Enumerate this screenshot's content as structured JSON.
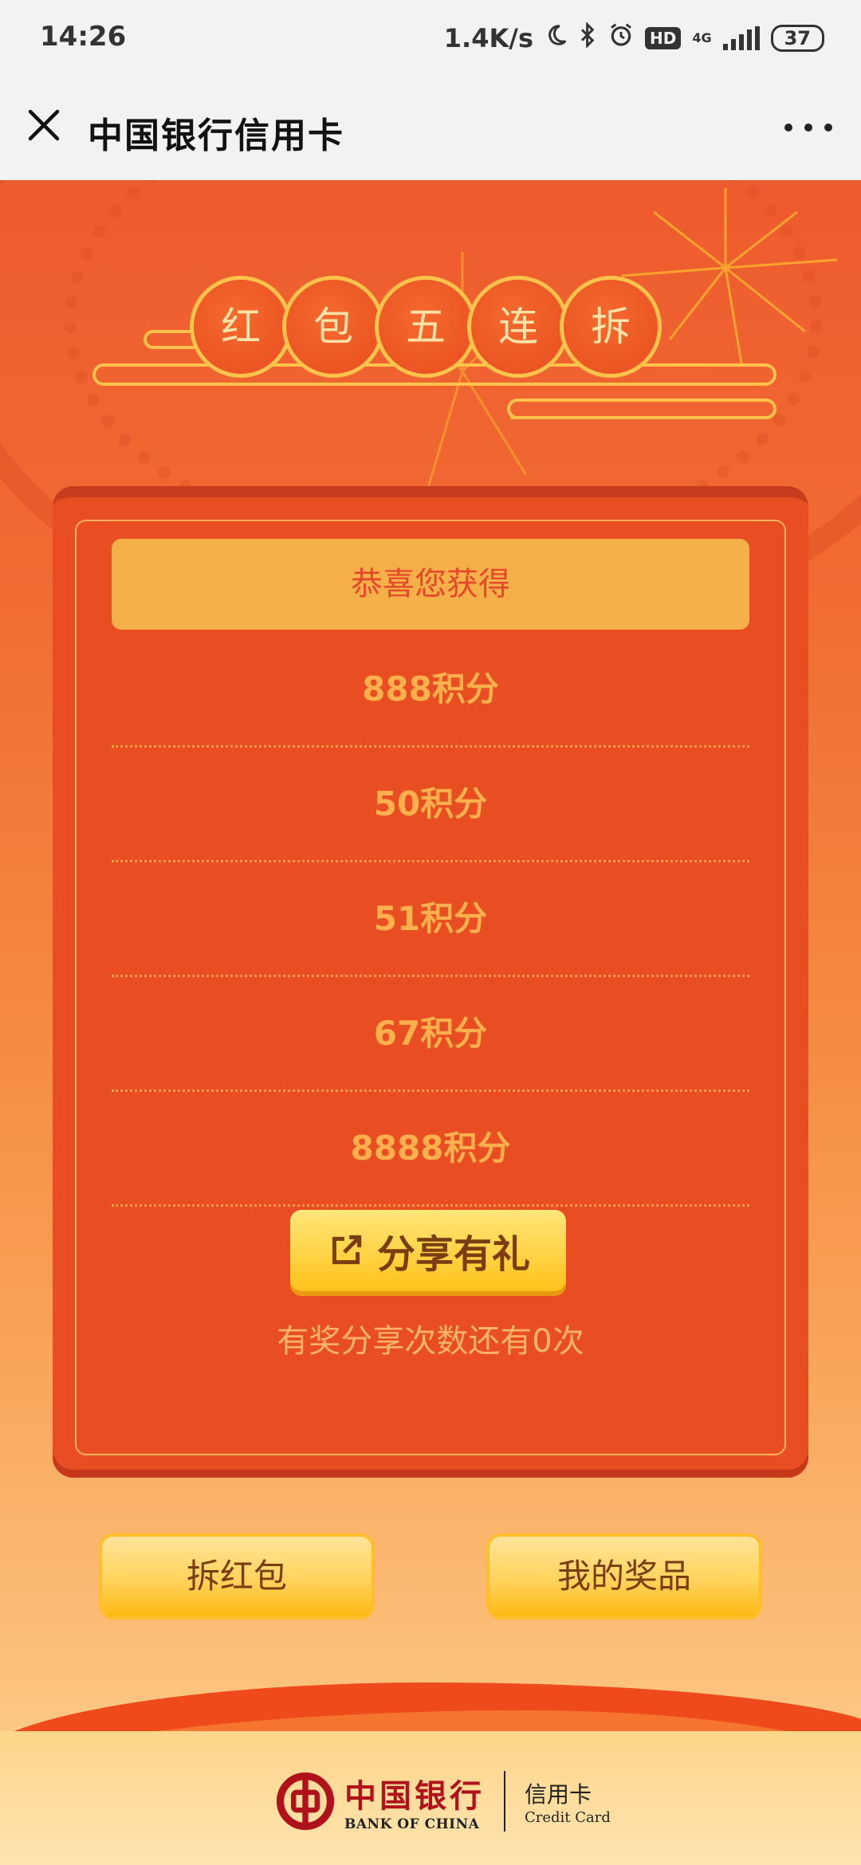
{
  "status_bar": {
    "time": "14:26",
    "net_speed": "1.4K/s",
    "hd": "HD",
    "network": "4G",
    "battery": "37"
  },
  "titlebar": {
    "title": "中国银行信用卡"
  },
  "header": {
    "chars": [
      "红",
      "包",
      "五",
      "连",
      "拆"
    ]
  },
  "card": {
    "banner": "恭喜您获得",
    "prizes": [
      "888积分",
      "50积分",
      "51积分",
      "67积分",
      "8888积分"
    ],
    "share_button": "分享有礼",
    "share_note": "有奖分享次数还有0次"
  },
  "actions": {
    "open": "拆红包",
    "my_prizes": "我的奖品"
  },
  "footer": {
    "bank_cn": "中国银行",
    "bank_en": "BANK OF CHINA",
    "card_cn": "信用卡",
    "card_en": "Credit Card"
  },
  "colors": {
    "accent": "#e94e22",
    "gold": "#ffc24a",
    "brand_red": "#b0121b"
  }
}
